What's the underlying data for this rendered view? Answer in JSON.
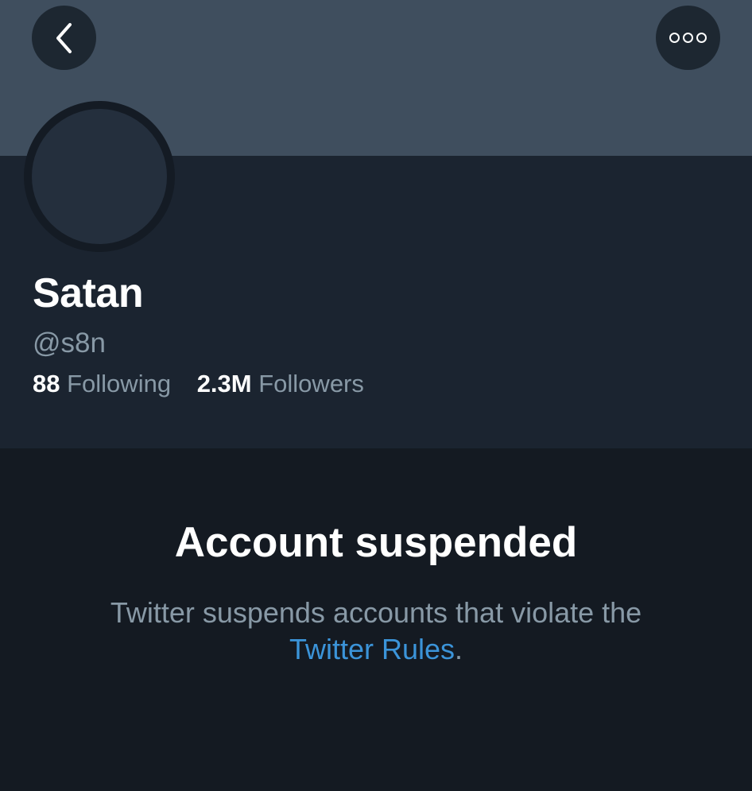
{
  "header": {
    "back_icon": "chevron-left-icon",
    "more_icon": "more-options-icon"
  },
  "profile": {
    "display_name": "Satan",
    "handle": "@s8n",
    "following_count": "88",
    "following_label": "Following",
    "followers_count": "2.3M",
    "followers_label": "Followers"
  },
  "notice": {
    "title": "Account suspended",
    "body_text": "Twitter suspends accounts that violate the",
    "link_text": "Twitter Rules",
    "trailing_text": "."
  },
  "colors": {
    "banner": "#3f4e5e",
    "profile_background": "#1b2430",
    "page_background": "#141a22",
    "secondary_text": "#8899a6",
    "link": "#3b94d9"
  }
}
